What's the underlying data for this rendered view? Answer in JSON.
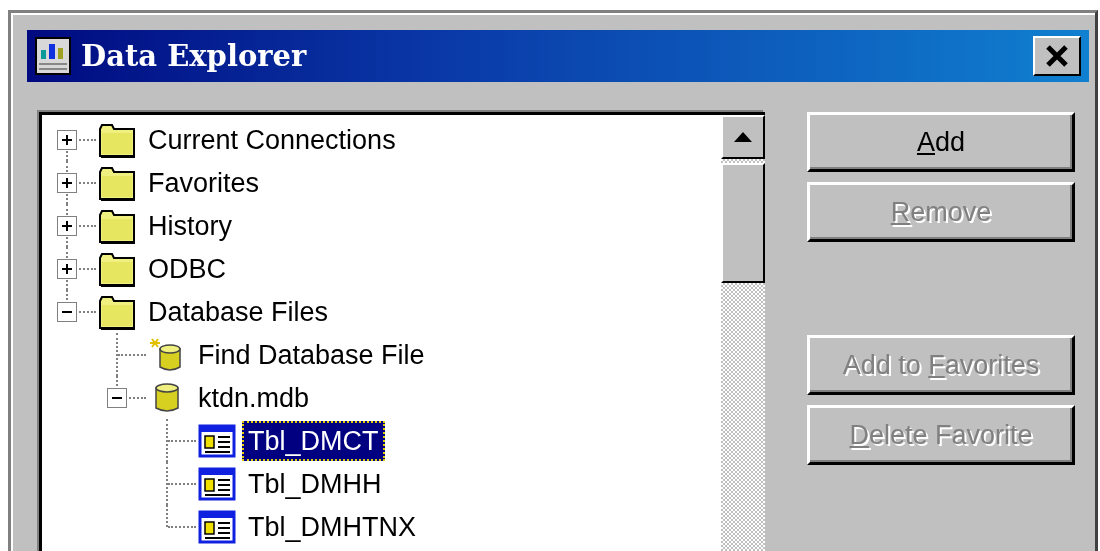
{
  "window": {
    "title": "Data Explorer"
  },
  "tree": {
    "items": [
      {
        "label": "Current Connections",
        "kind": "folder",
        "expanded": false,
        "selected": false
      },
      {
        "label": "Favorites",
        "kind": "folder",
        "expanded": false,
        "selected": false
      },
      {
        "label": "History",
        "kind": "folder",
        "expanded": false,
        "selected": false
      },
      {
        "label": "ODBC",
        "kind": "folder",
        "expanded": false,
        "selected": false
      },
      {
        "label": "Database Files",
        "kind": "folder",
        "expanded": true,
        "selected": false,
        "children": [
          {
            "label": "Find Database File",
            "kind": "find",
            "selected": false
          },
          {
            "label": "ktdn.mdb",
            "kind": "database",
            "expanded": true,
            "selected": false,
            "children": [
              {
                "label": "Tbl_DMCT",
                "kind": "table",
                "selected": true
              },
              {
                "label": "Tbl_DMHH",
                "kind": "table",
                "selected": false
              },
              {
                "label": "Tbl_DMHTNX",
                "kind": "table",
                "selected": false
              }
            ]
          }
        ]
      }
    ]
  },
  "buttons": [
    {
      "access_key": "A",
      "label_after": "dd",
      "disabled": false
    },
    {
      "access_key": "R",
      "label_after": "emove",
      "disabled": true
    },
    {
      "label_before": "Add to ",
      "access_key": "F",
      "label_after": "avorites",
      "disabled": true,
      "group_start": true
    },
    {
      "access_key": "D",
      "label_after": "elete Favorite",
      "disabled": true
    }
  ]
}
